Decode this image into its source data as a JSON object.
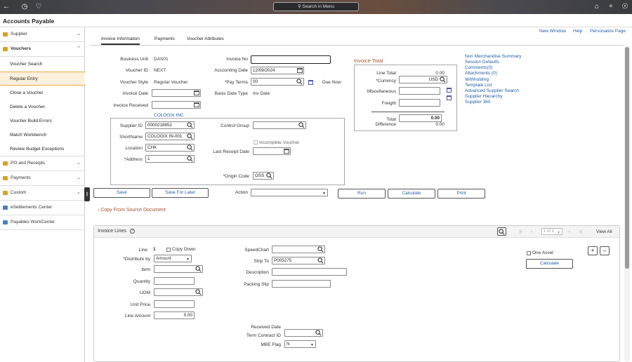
{
  "topbar": {
    "search_placeholder": "Search in Menu"
  },
  "app": {
    "title": "Accounts Payable"
  },
  "sidebar": {
    "groups": [
      {
        "label": "Supplier"
      },
      {
        "label": "Vouchers"
      },
      {
        "label": "PO and Receipts"
      },
      {
        "label": "Payments"
      },
      {
        "label": "Custom"
      },
      {
        "label": "eSettlements Center"
      },
      {
        "label": "Payables WorkCenter"
      }
    ],
    "voucher_items": [
      {
        "label": "Voucher Search"
      },
      {
        "label": "Regular Entry"
      },
      {
        "label": "Close a Voucher"
      },
      {
        "label": "Delete a Voucher"
      },
      {
        "label": "Voucher Build Errors"
      },
      {
        "label": "Match Workbench"
      },
      {
        "label": "Review Budget Exceptions"
      }
    ]
  },
  "links": {
    "new_window": "New Window",
    "help": "Help",
    "personalize": "Personalize Page"
  },
  "tabs": [
    {
      "label": "Invoice Information"
    },
    {
      "label": "Payments"
    },
    {
      "label": "Voucher Attributes"
    }
  ],
  "header": {
    "business_unit_label": "Business Unit",
    "business_unit": "DAS01",
    "voucher_id_label": "Voucher ID",
    "voucher_id": "NEXT",
    "voucher_style_label": "Voucher Style",
    "voucher_style": "Regular Voucher",
    "invoice_date_label": "Invoice Date",
    "invoice_received_label": "Invoice Received",
    "invoice_no_label": "Invoice No",
    "invoice_no": "",
    "accounting_date_label": "Accounting Date",
    "accounting_date": "12/09/2024",
    "pay_terms_label": "*Pay Terms",
    "pay_terms": "00",
    "due_now": "Due Now",
    "basis_date_type_label": "Basis Date Type",
    "basis_date_type": "Inv Date"
  },
  "supplier": {
    "name_link": "COLOGIX INC",
    "supplier_id_label": "Supplier ID",
    "supplier_id": "0000218852",
    "shortname_label": "ShortName",
    "shortname": "COLOGIX IN-001",
    "location_label": "Location",
    "location": "CHK",
    "address_label": "*Address",
    "address": "1",
    "control_group_label": "Control Group",
    "incomplete_voucher": "Incomplete Voucher",
    "last_receipt_date_label": "Last Receipt Date",
    "origin_code_label": "*Origin Code",
    "origin_code": "OSS"
  },
  "invoice_total": {
    "title": "Invoice Total",
    "line_total_label": "Line Total",
    "line_total": "0.00",
    "currency_label": "*Currency",
    "currency": "USD",
    "misc_label": "Miscellaneous",
    "freight_label": "Freight",
    "total_label": "Total",
    "total": "0.00",
    "difference_label": "Difference",
    "difference": "0.00"
  },
  "side_links": [
    "Non Merchandise Summary",
    "Session Defaults",
    "Comments(0)",
    "Attachments (0)",
    "Withholding",
    "Template List",
    "Advanced Supplier Search",
    "Supplier Hierarchy",
    "Supplier 360"
  ],
  "actions": {
    "save": "Save",
    "save_later": "Save For Later",
    "action_label": "Action",
    "run": "Run",
    "calculate": "Calculate",
    "print": "Print"
  },
  "copy_from": "Copy From Source Document",
  "invoice_lines": {
    "title": "Invoice Lines",
    "pager": "1 of 1",
    "view_all": "View All",
    "line_label": "Line",
    "line": "1",
    "copy_down": "Copy Down",
    "distribute_label": "*Distribute by",
    "distribute": "Amount",
    "item_label": "Item",
    "quantity_label": "Quantity",
    "uom_label": "UOM",
    "unit_price_label": "Unit Price",
    "line_amount_label": "Line Amount",
    "line_amount": "0.00",
    "speedchart_label": "SpeedChart",
    "ship_to_label": "Ship To",
    "ship_to": "P005275",
    "description_label": "Description",
    "packing_slip_label": "Packing Slip",
    "received_date_label": "Received Date",
    "term_contract_label": "Term Contract ID",
    "mbe_flag_label": "MBE Flag",
    "mbe_flag": "N",
    "one_asset": "One Asset",
    "calculate": "Calculate"
  }
}
